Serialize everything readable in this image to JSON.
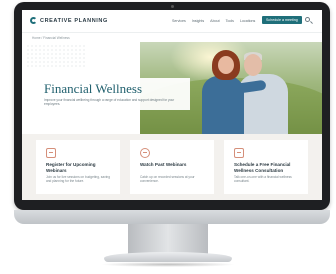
{
  "site": {
    "brand": "CREATIVE PLANNING",
    "nav": [
      "Services",
      "Insights",
      "About",
      "Tools",
      "Locations"
    ],
    "cta": "Schedule a meeting",
    "breadcrumb": "Home / Financial Wellness"
  },
  "hero": {
    "title": "Financial Wellness",
    "subtitle": "Improve your financial wellbeing through a range of education and support designed for your employees."
  },
  "cards": [
    {
      "title": "Register for Upcoming Webinars",
      "description": "Join us for live sessions on budgeting, saving and planning for the future.",
      "icon": "calendar-icon"
    },
    {
      "title": "Watch Past Webinars",
      "description": "Catch up on recorded sessions at your convenience.",
      "icon": "play-icon"
    },
    {
      "title": "Schedule a Free Financial Wellness Consultation",
      "description": "Talk one-on-one with a financial wellness consultant.",
      "icon": "people-icon"
    }
  ]
}
